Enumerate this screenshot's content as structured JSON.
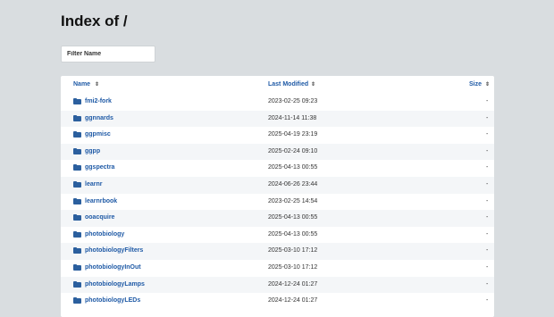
{
  "page": {
    "title": "Index of /"
  },
  "filter": {
    "placeholder": "Filter Name"
  },
  "table": {
    "headers": {
      "name": "Name",
      "modified": "Last Modified",
      "size": "Size"
    },
    "sort_glyph": "⇕",
    "rows": [
      {
        "name": "fmi2-fork",
        "date": "2023-02-25 09:23",
        "size": "-"
      },
      {
        "name": "ggnnards",
        "date": "2024-11-14 11:38",
        "size": "-"
      },
      {
        "name": "ggpmisc",
        "date": "2025-04-19 23:19",
        "size": "-"
      },
      {
        "name": "ggpp",
        "date": "2025-02-24 09:10",
        "size": "-"
      },
      {
        "name": "ggspectra",
        "date": "2025-04-13 00:55",
        "size": "-"
      },
      {
        "name": "learnr",
        "date": "2024-06-26 23:44",
        "size": "-"
      },
      {
        "name": "learnrbook",
        "date": "2023-02-25 14:54",
        "size": "-"
      },
      {
        "name": "ooacquire",
        "date": "2025-04-13 00:55",
        "size": "-"
      },
      {
        "name": "photobiology",
        "date": "2025-04-13 00:55",
        "size": "-"
      },
      {
        "name": "photobiologyFilters",
        "date": "2025-03-10 17:12",
        "size": "-"
      },
      {
        "name": "photobiologyInOut",
        "date": "2025-03-10 17:12",
        "size": "-"
      },
      {
        "name": "photobiologyLamps",
        "date": "2024-12-24 01:27",
        "size": "-"
      },
      {
        "name": "photobiologyLEDs",
        "date": "2024-12-24 01:27",
        "size": "-"
      }
    ]
  },
  "icons": {
    "row_icon": "folder-icon",
    "sort_icon": "sort-icon"
  },
  "colors": {
    "link": "#1f5aa6",
    "folder": "#2b5f9e",
    "background": "#d9dde0"
  }
}
